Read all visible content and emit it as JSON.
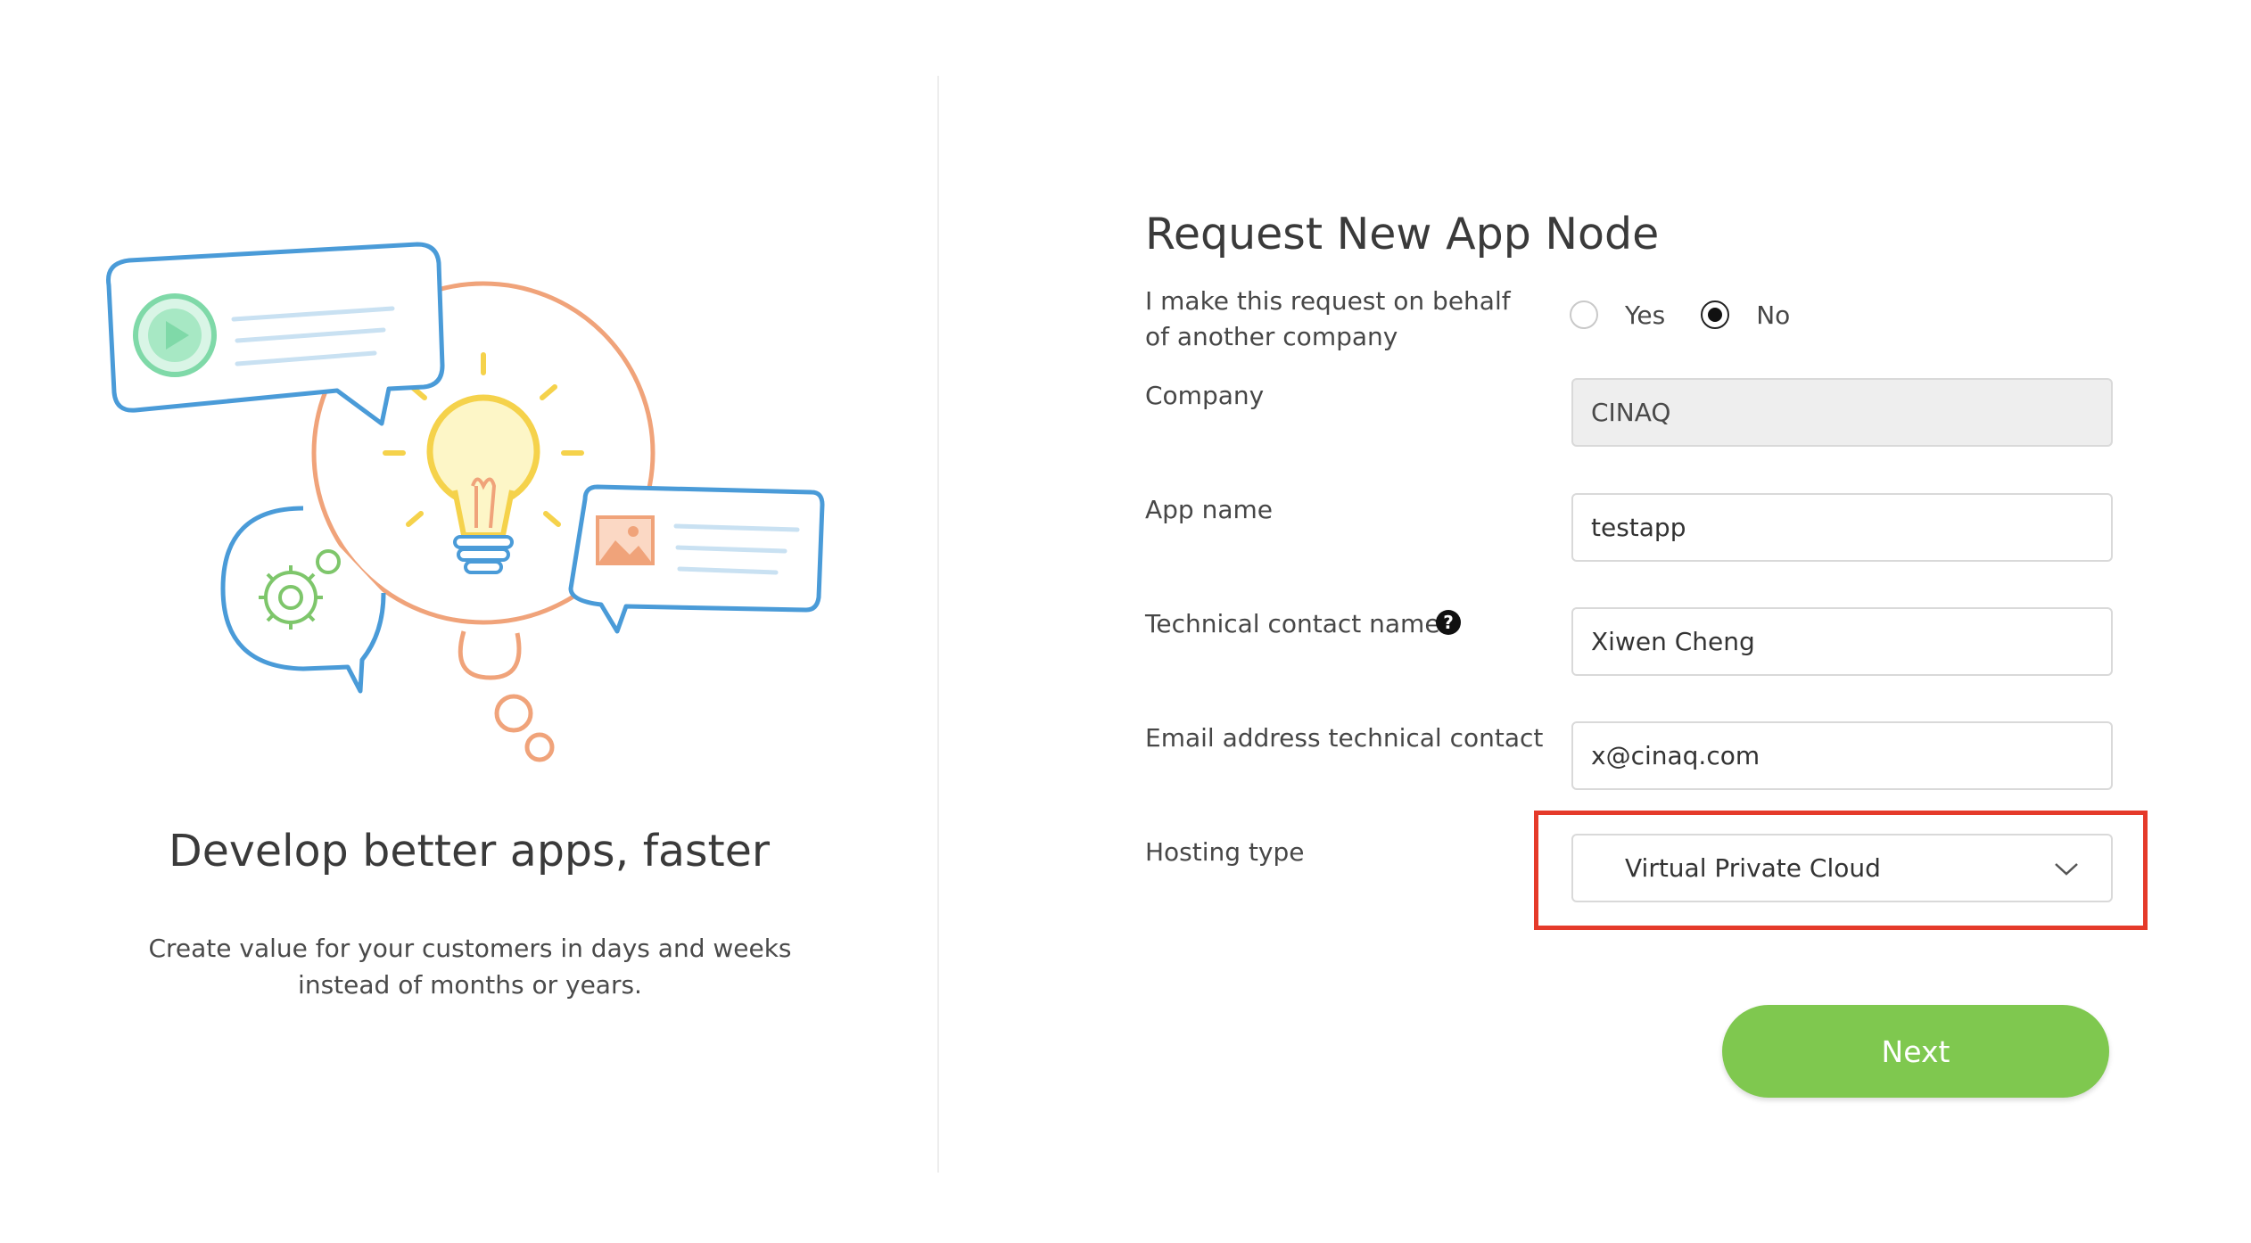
{
  "promo": {
    "title": "Develop better apps, faster",
    "description": "Create value for your customers in days and weeks instead of months or years."
  },
  "form": {
    "title": "Request New App Node",
    "behalf": {
      "label": "I make this request on behalf of another company",
      "options": [
        {
          "label": "Yes",
          "checked": false
        },
        {
          "label": "No",
          "checked": true
        }
      ]
    },
    "company": {
      "label": "Company",
      "value": "CINAQ"
    },
    "app_name": {
      "label": "App name",
      "value": "testapp"
    },
    "tech_contact": {
      "label": "Technical contact name",
      "value": "Xiwen Cheng",
      "help_icon": "question-circle-icon"
    },
    "email": {
      "label": "Email address technical contact",
      "value": "x@cinaq.com"
    },
    "hosting": {
      "label": "Hosting type",
      "value": "Virtual Private Cloud"
    },
    "next_label": "Next"
  },
  "colors": {
    "accent_green": "#7fc84f",
    "highlight_red": "#e53a2a",
    "illustration_blue": "#4a9bd8",
    "illustration_orange": "#f0a37a",
    "bulb_yellow": "#f5d24b",
    "play_green": "#7fd9a8"
  }
}
